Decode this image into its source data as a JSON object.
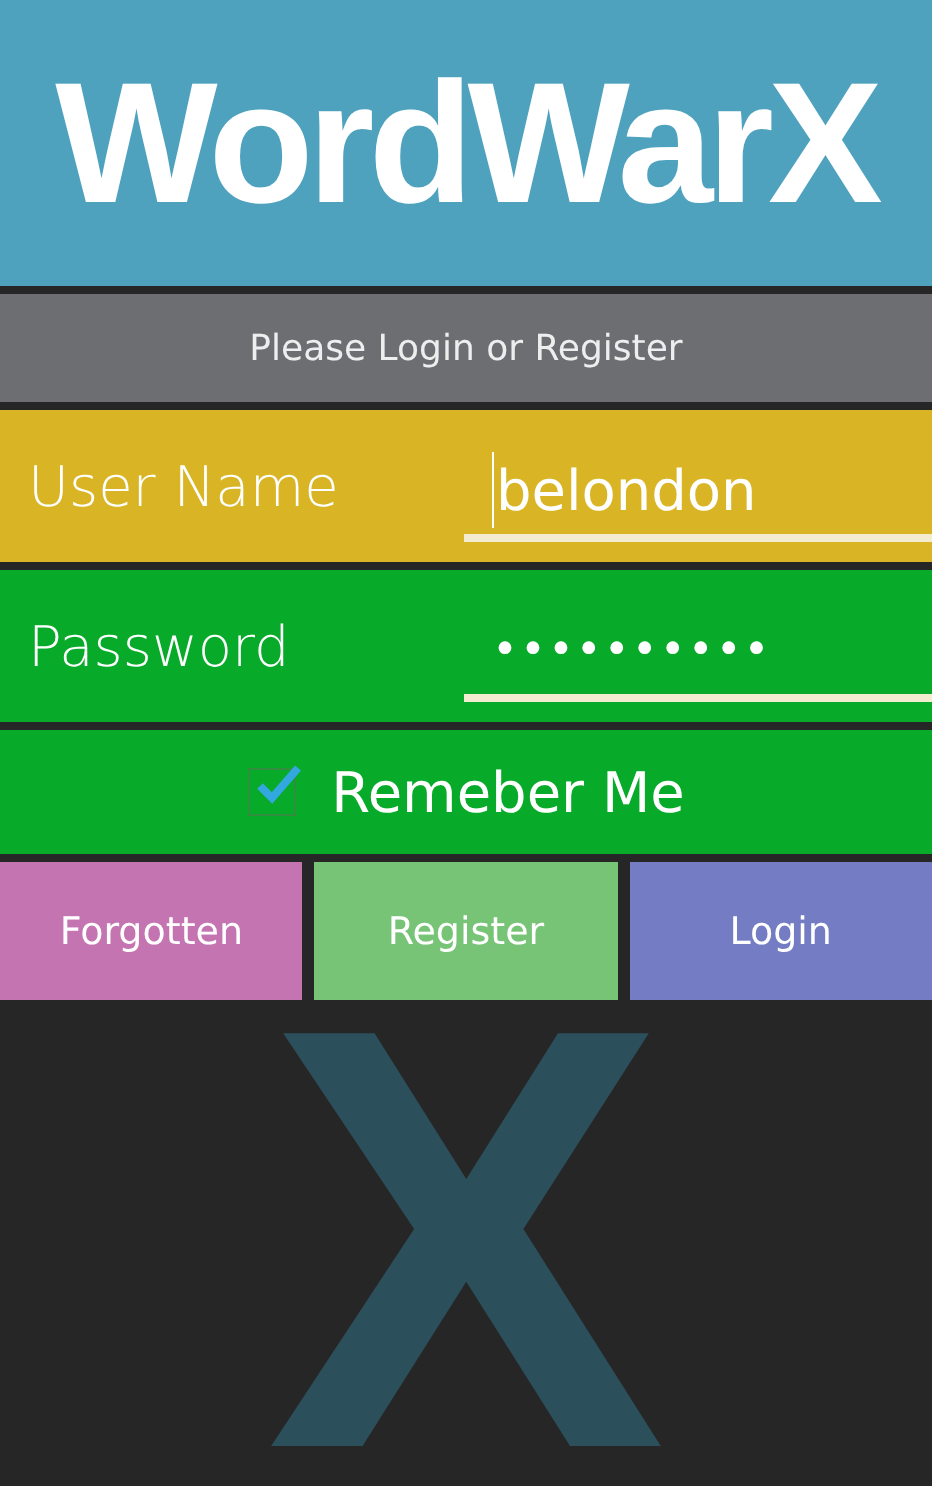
{
  "app_title": "WordWarX",
  "banner": "Please Login or Register",
  "fields": [
    {
      "kind": "text",
      "label": "User Name",
      "value": "belondon",
      "focused": true,
      "color": "#d9b526"
    },
    {
      "kind": "password",
      "label": "Password",
      "value": "••••••••••",
      "focused": false,
      "color": "#08aa2a"
    }
  ],
  "remember": {
    "label": "Remeber Me",
    "checked": true
  },
  "buttons": [
    {
      "label": "Forgotten",
      "color": "#c475b1"
    },
    {
      "label": "Register",
      "color": "#77c477"
    },
    {
      "label": "Login",
      "color": "#747cc4"
    }
  ],
  "logo_letter": "X"
}
